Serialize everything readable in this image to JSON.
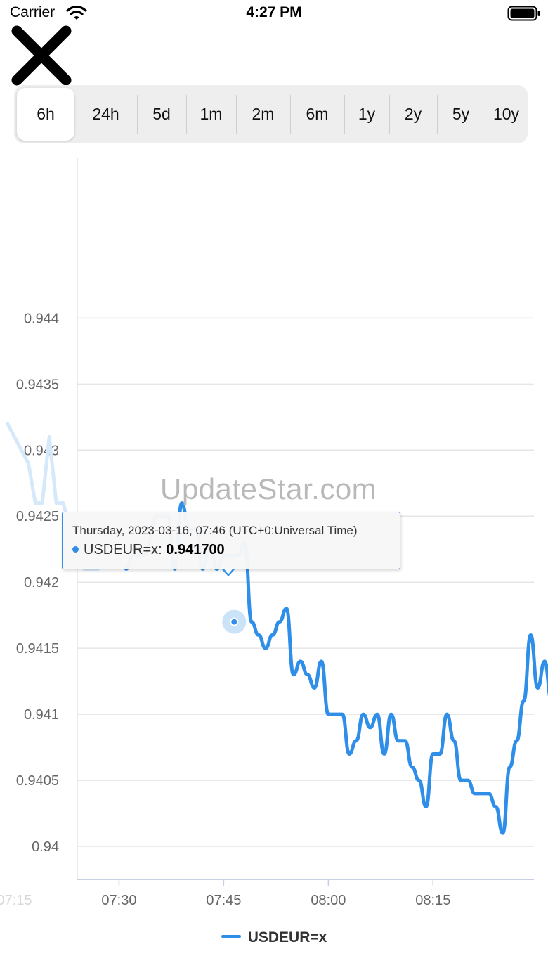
{
  "status_bar": {
    "carrier": "Carrier",
    "time": "4:27 PM"
  },
  "ranges": {
    "selected": "6h",
    "items": [
      "6h",
      "24h",
      "5d",
      "1m",
      "2m",
      "6m",
      "1y",
      "2y",
      "5y",
      "10y"
    ]
  },
  "watermark": "UpdateStar.com",
  "tooltip": {
    "date": "Thursday, 2023-03-16, 07:46 (UTC+0:Universal Time)",
    "series_label": "USDEUR=x:",
    "value": "0.941700"
  },
  "colors": {
    "series": "#2f8fe8",
    "navigator": "#d6e9fb",
    "grid": "#e6e6e6"
  },
  "chart_data": {
    "type": "line",
    "xlabel": "",
    "ylabel": "",
    "ylim": [
      0.93975,
      0.94521
    ],
    "y_ticks": [
      "0.944",
      "0.9435",
      "0.943",
      "0.9425",
      "0.942",
      "0.9415",
      "0.941",
      "0.9405",
      "0.94"
    ],
    "y_tick_values": [
      0.944,
      0.9435,
      0.943,
      0.9425,
      0.942,
      0.9415,
      0.941,
      0.9405,
      0.94
    ],
    "x_ticks": [
      "07:15",
      "07:30",
      "07:45",
      "08:00",
      "08:15"
    ],
    "x_tick_minutes": [
      0,
      15,
      30,
      45,
      60
    ],
    "series": [
      {
        "name": "USDEUR=x",
        "x_minutes": [
          16,
          17,
          18.5,
          20.5,
          22,
          23,
          24,
          25,
          26,
          27,
          28,
          29,
          30,
          31,
          32,
          33,
          34,
          35,
          36,
          37,
          38,
          39,
          40,
          41,
          42,
          43,
          44,
          45,
          46,
          47,
          48,
          49,
          50,
          51,
          52,
          53,
          54,
          55,
          56,
          57,
          58,
          59,
          60,
          61,
          62,
          63,
          64,
          65,
          66,
          67,
          68,
          69,
          70
        ],
        "values": [
          0.9421,
          0.9422,
          0.9422,
          0.9425,
          0.9425,
          0.9421,
          0.9426,
          0.9424,
          0.9424,
          0.9421,
          0.9423,
          0.9421,
          0.9422,
          0.9422,
          0.9422,
          0.9423,
          0.9417,
          0.9416,
          0.9415,
          0.9416,
          0.9417,
          0.9418,
          0.9413,
          0.9414,
          0.9413,
          0.9412,
          0.9414,
          0.941,
          0.941,
          0.941,
          0.9407,
          0.9408,
          0.941,
          0.9409,
          0.941,
          0.9407,
          0.941,
          0.9408,
          0.9408,
          0.9406,
          0.9405,
          0.9403,
          0.9407,
          0.9407,
          0.941,
          0.9408,
          0.9405,
          0.9405,
          0.9404,
          0.9404,
          0.9404,
          0.9403,
          0.9401
        ]
      },
      {
        "name": "",
        "x_minutes": [
          71,
          72,
          73,
          74,
          75,
          76,
          77,
          78,
          78.5,
          78.5
        ],
        "values": [
          0.9406,
          0.9408,
          0.9411,
          0.9416,
          0.9412,
          0.9414,
          0.9411,
          0.9413,
          0.9413,
          0.9408
        ]
      }
    ],
    "navigator_series": {
      "x_minutes": [
        -1,
        0,
        1,
        2,
        3,
        4,
        5,
        6,
        7,
        8,
        9,
        10,
        11,
        12
      ],
      "values": [
        0.9432,
        0.9431,
        0.943,
        0.9429,
        0.9426,
        0.9426,
        0.9431,
        0.9426,
        0.9426,
        0.9424,
        0.9422,
        0.9421,
        0.9421,
        0.9421
      ]
    },
    "highlight": {
      "x_minute": 31.5,
      "value": 0.9417
    },
    "legend": {
      "placement": "bottom-center",
      "label": "USDEUR=x"
    },
    "grid": true
  }
}
